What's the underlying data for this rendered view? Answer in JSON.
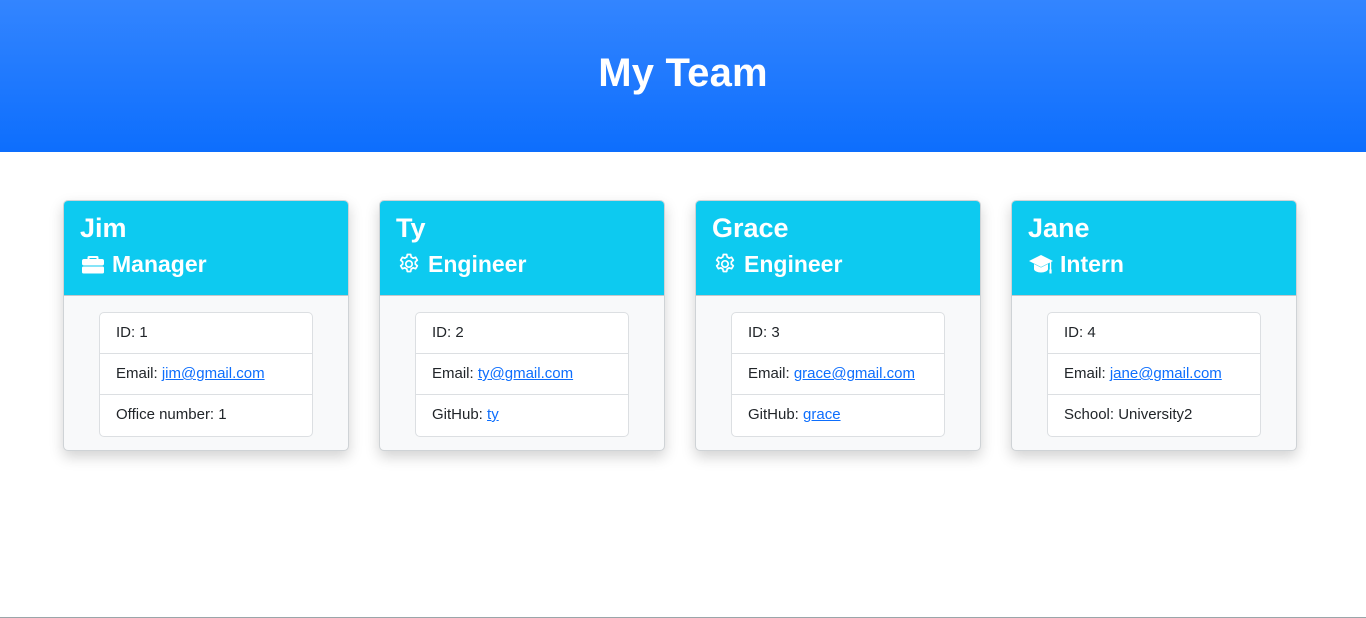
{
  "header": {
    "title": "My Team"
  },
  "colors": {
    "banner": "#0d6efd",
    "card_header": "#0dcaf0",
    "link": "#0d6efd"
  },
  "cards": [
    {
      "name": "Jim",
      "role": "Manager",
      "icon": "briefcase-icon",
      "id_label": "ID: ",
      "id": "1",
      "email_label": "Email: ",
      "email": "jim@gmail.com",
      "extra_label": "Office number: ",
      "extra_value": "1"
    },
    {
      "name": "Ty",
      "role": "Engineer",
      "icon": "gear-icon",
      "id_label": "ID: ",
      "id": "2",
      "email_label": "Email: ",
      "email": "ty@gmail.com",
      "extra_label": "GitHub: ",
      "extra_value": "ty"
    },
    {
      "name": "Grace",
      "role": "Engineer",
      "icon": "gear-icon",
      "id_label": "ID: ",
      "id": "3",
      "email_label": "Email: ",
      "email": "grace@gmail.com",
      "extra_label": "GitHub: ",
      "extra_value": "grace"
    },
    {
      "name": "Jane",
      "role": "Intern",
      "icon": "graduation-cap-icon",
      "id_label": "ID: ",
      "id": "4",
      "email_label": "Email: ",
      "email": "jane@gmail.com",
      "extra_label": "School: ",
      "extra_value": "University2"
    }
  ]
}
